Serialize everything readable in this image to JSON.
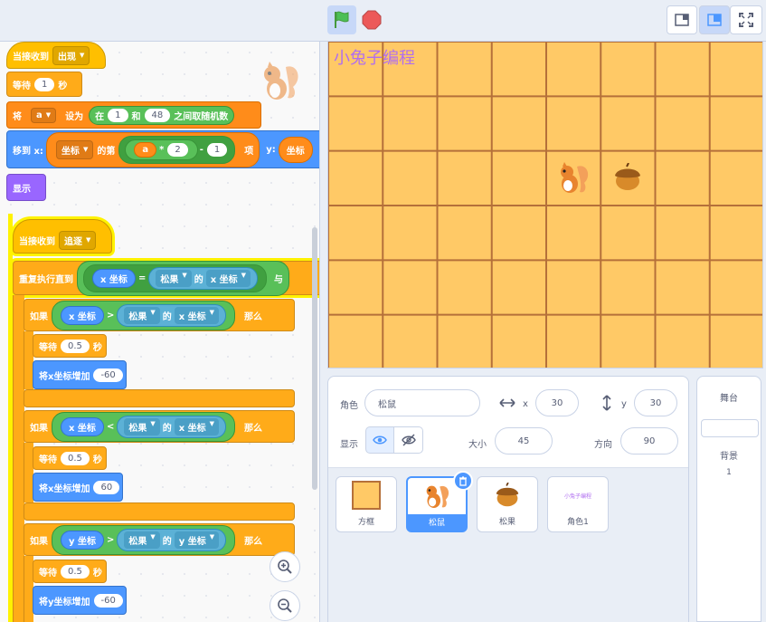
{
  "code": {
    "script1": {
      "hat_label": "当接收到",
      "hat_msg": "出现",
      "wait_label": "等待",
      "wait_val": "1",
      "wait_unit": "秒",
      "set_label": "将",
      "set_var": "a",
      "set_to": "设为",
      "rand_in": "在",
      "rand_from": "1",
      "rand_and": "和",
      "rand_to": "48",
      "rand_pick": "之间取随机数",
      "move_label": "移到 x:",
      "list_name": "坐标",
      "list_item": "的第",
      "expr_var": "a",
      "expr_mul": "*",
      "expr_two": "2",
      "expr_minus": "-",
      "expr_one": "1",
      "list_item_end": "项",
      "move_y": "y:",
      "list_name2": "坐标",
      "show_label": "显示"
    },
    "script2": {
      "hat_label": "当接收到",
      "hat_msg": "追逐",
      "repeat_label": "重复执行直到",
      "cond_a": "x 坐标",
      "cond_eq": "=",
      "cond_obj": "松果",
      "cond_of": "的",
      "cond_prop": "x 坐标",
      "cond_and": "与",
      "if1": {
        "label": "如果",
        "left": "x 坐标",
        "op": ">",
        "obj": "松果",
        "of": "的",
        "prop": "x 坐标",
        "then": "那么",
        "wait": "等待",
        "wait_val": "0.5",
        "wait_unit": "秒",
        "change": "将x坐标增加",
        "change_val": "-60"
      },
      "if2": {
        "label": "如果",
        "left": "x 坐标",
        "op": "<",
        "obj": "松果",
        "of": "的",
        "prop": "x 坐标",
        "then": "那么",
        "wait": "等待",
        "wait_val": "0.5",
        "wait_unit": "秒",
        "change": "将x坐标增加",
        "change_val": "60"
      },
      "if3": {
        "label": "如果",
        "left": "y 坐标",
        "op": ">",
        "obj": "松果",
        "of": "的",
        "prop": "y 坐标",
        "then": "那么",
        "wait": "等待",
        "wait_val": "0.5",
        "wait_unit": "秒",
        "change": "将y坐标增加",
        "change_val": "-60"
      }
    }
  },
  "stage": {
    "text": "小兔子编程",
    "bg_color": "#ffc966",
    "grid_color": "#b5703a"
  },
  "sprite_info": {
    "sprite_label": "角色",
    "sprite_name": "松鼠",
    "x_label": "x",
    "x_val": "30",
    "y_label": "y",
    "y_val": "30",
    "show_label": "显示",
    "size_label": "大小",
    "size_val": "45",
    "dir_label": "方向",
    "dir_val": "90"
  },
  "sprites": [
    {
      "name": "方框"
    },
    {
      "name": "松鼠"
    },
    {
      "name": "松果"
    },
    {
      "name": "角色1",
      "thumb_text": "小兔子编程"
    }
  ],
  "stage_panel": {
    "title": "舞台",
    "backdrop_label": "背景",
    "backdrop_count": "1"
  },
  "colors": {
    "accent": "#4c97ff",
    "events": "#ffbf00",
    "control": "#ffab19",
    "motion": "#4c97ff",
    "looks": "#9966ff",
    "operators": "#59c059",
    "sensing": "#5cb1d6",
    "variables": "#ff8c1a"
  }
}
